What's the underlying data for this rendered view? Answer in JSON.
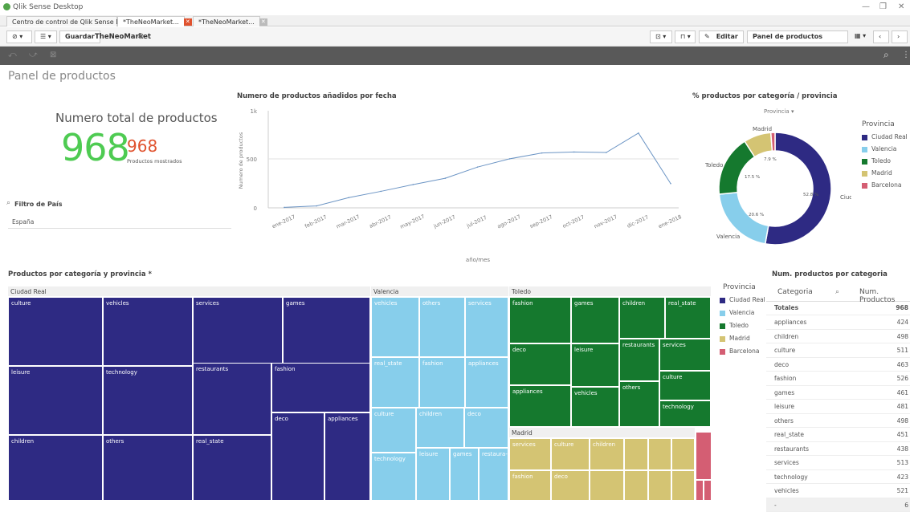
{
  "window": {
    "title": "Qlik Sense Desktop"
  },
  "tabs": [
    {
      "label": "Centro de control de Qlik Sense Desktop"
    },
    {
      "label": "*TheNeoMarket..."
    },
    {
      "label": "*TheNeoMarket..."
    }
  ],
  "toolbar": {
    "save_label": "Guardar",
    "app_name": "TheNeoMarket",
    "edit_label": "Editar",
    "sheet_selector": "Panel de productos"
  },
  "sheet": {
    "title": "Panel de productos"
  },
  "kpi": {
    "label": "Numero total de productos",
    "value": "968",
    "secondary_value": "968",
    "secondary_label": "Productos mostrados",
    "colors": {
      "main": "#4ecb52",
      "secondary": "#e0522e"
    }
  },
  "filter": {
    "title": "Filtro de País",
    "value": "España"
  },
  "line_chart": {
    "title": "Numero de productos añadidos por fecha",
    "xlabel": "año/mes",
    "ylabel": "Numero de productos",
    "yticks": [
      "1k",
      "500",
      "0"
    ]
  },
  "donut": {
    "title": "% productos por categoría / provincia",
    "dimension_label": "Provincia",
    "legend_title": "Provincia",
    "legend": [
      "Ciudad Real",
      "Valencia",
      "Toledo",
      "Madrid",
      "Barcelona"
    ],
    "labels": {
      "madrid": "Madrid",
      "toledo": "Toledo",
      "valencia": "Valencia",
      "ciudad": "Ciudad..."
    },
    "pct_labels": [
      "7.9 %",
      "17.5 %",
      "52.8 %",
      "20.6 %"
    ]
  },
  "treemap": {
    "title": "Productos por categoría y provincia *",
    "legend_title": "Provincia",
    "legend": [
      "Ciudad Real",
      "Valencia",
      "Toledo",
      "Madrid",
      "Barcelona"
    ],
    "groups": {
      "ciudad_real": "Ciudad Real",
      "valencia": "Valencia",
      "toledo": "Toledo",
      "madrid": "Madrid"
    },
    "cr": [
      "culture",
      "vehicles",
      "services",
      "games",
      "leisure",
      "technology",
      "restaurants",
      "fashion",
      "deco",
      "appliances",
      "children",
      "others",
      "real_state"
    ],
    "va": [
      "vehicles",
      "others",
      "services",
      "real_state",
      "fashion",
      "appliances",
      "culture",
      "children",
      "deco",
      "technology",
      "leisure",
      "games",
      "restaura-nts"
    ],
    "to": [
      "fashion",
      "games",
      "children",
      "real_state",
      "deco",
      "leisure",
      "restaurants",
      "services",
      "culture",
      "appliances",
      "vehicles",
      "others",
      "technology"
    ],
    "ma": [
      "services",
      "culture",
      "children",
      "fashion",
      "deco"
    ]
  },
  "table": {
    "title": "Num. productos por categoria",
    "col1": "Categoria",
    "col2": "Num. Productos",
    "total_label": "Totales",
    "total_value": "968",
    "rows": [
      {
        "cat": "appliances",
        "val": "424"
      },
      {
        "cat": "children",
        "val": "498"
      },
      {
        "cat": "culture",
        "val": "511"
      },
      {
        "cat": "deco",
        "val": "463"
      },
      {
        "cat": "fashion",
        "val": "526"
      },
      {
        "cat": "games",
        "val": "461"
      },
      {
        "cat": "leisure",
        "val": "481"
      },
      {
        "cat": "others",
        "val": "498"
      },
      {
        "cat": "real_state",
        "val": "451"
      },
      {
        "cat": "restaurants",
        "val": "438"
      },
      {
        "cat": "services",
        "val": "513"
      },
      {
        "cat": "technology",
        "val": "423"
      },
      {
        "cat": "vehicles",
        "val": "521"
      },
      {
        "cat": "-",
        "val": "6"
      }
    ]
  },
  "colors": {
    "ciudad_real": "#2e2a83",
    "valencia": "#87ceeb",
    "toledo": "#15792e",
    "madrid": "#d4c473",
    "barcelona": "#d45e73"
  },
  "chart_data": [
    {
      "type": "line",
      "title": "Numero de productos añadidos por fecha",
      "xlabel": "año/mes",
      "ylabel": "Numero de productos",
      "x": [
        "ene-2017",
        "feb-2017",
        "mar-2017",
        "abr-2017",
        "may-2017",
        "jun-2017",
        "jul-2017",
        "ago-2017",
        "sep-2017",
        "oct-2017",
        "nov-2017",
        "dic-2017",
        "ene-2018"
      ],
      "values": [
        5,
        20,
        105,
        170,
        240,
        305,
        420,
        505,
        565,
        575,
        570,
        770,
        250
      ],
      "ylim": [
        0,
        1000
      ],
      "grid": true
    },
    {
      "type": "pie",
      "title": "% productos por categoría / provincia",
      "categories": [
        "Ciudad Real",
        "Valencia",
        "Toledo",
        "Madrid",
        "Barcelona"
      ],
      "values": [
        52.8,
        20.6,
        17.5,
        7.9,
        1.2
      ],
      "legend": "right"
    }
  ]
}
